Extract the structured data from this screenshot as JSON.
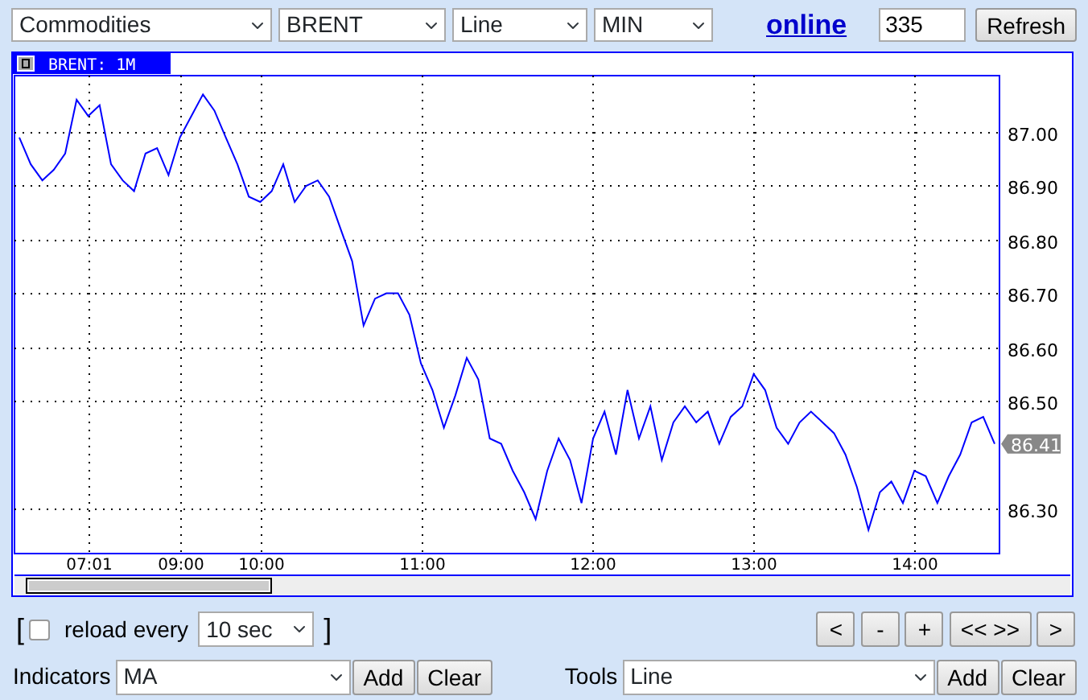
{
  "toolbar": {
    "selects": [
      {
        "value": "Commodities"
      },
      {
        "value": "BRENT"
      },
      {
        "value": "Line"
      },
      {
        "value": "MIN"
      }
    ],
    "online_link": "online",
    "count_field": {
      "value": "335"
    },
    "refresh_button": "Refresh"
  },
  "chart": {
    "tab_label": "BRENT: 1M",
    "chart_data": {
      "type": "line",
      "grid": true,
      "ylim": [
        86.216,
        87.105
      ],
      "yticks": [
        {
          "value": 86.3,
          "label": "86.30"
        },
        {
          "value": 86.5,
          "label": "86.50"
        },
        {
          "value": 86.6,
          "label": "86.60"
        },
        {
          "value": 86.7,
          "label": "86.70"
        },
        {
          "value": 86.8,
          "label": "86.80"
        },
        {
          "value": 86.9,
          "label": "86.90"
        },
        {
          "value": 87.0,
          "label": "87.00"
        }
      ],
      "categories": [
        null,
        null,
        null,
        null,
        null,
        null,
        "07:01",
        null,
        null,
        null,
        null,
        null,
        null,
        null,
        "09:00",
        null,
        null,
        null,
        null,
        null,
        null,
        "10:00",
        null,
        null,
        null,
        null,
        null,
        null,
        null,
        null,
        null,
        null,
        null,
        null,
        null,
        "11:00",
        null,
        null,
        null,
        null,
        null,
        null,
        null,
        null,
        null,
        null,
        null,
        null,
        null,
        null,
        "12:00",
        null,
        null,
        null,
        null,
        null,
        null,
        null,
        null,
        null,
        null,
        null,
        null,
        null,
        "13:00",
        null,
        null,
        null,
        null,
        null,
        null,
        null,
        null,
        null,
        null,
        null,
        null,
        null,
        "14:00",
        null,
        null,
        null,
        null,
        null,
        null,
        null
      ],
      "series": [
        {
          "color": "#0000ff",
          "values": [
            86.99,
            86.94,
            86.91,
            86.93,
            86.96,
            87.06,
            87.03,
            87.05,
            86.94,
            86.91,
            86.89,
            86.96,
            86.97,
            86.92,
            86.99,
            87.03,
            87.07,
            87.04,
            86.99,
            86.94,
            86.88,
            86.87,
            86.89,
            86.94,
            86.87,
            86.9,
            86.91,
            86.88,
            86.82,
            86.76,
            86.64,
            86.69,
            86.7,
            86.7,
            86.66,
            86.57,
            86.52,
            86.45,
            86.51,
            86.58,
            86.54,
            86.43,
            86.42,
            86.37,
            86.33,
            86.28,
            86.37,
            86.43,
            86.39,
            86.31,
            86.43,
            86.48,
            86.4,
            86.52,
            86.43,
            86.49,
            86.39,
            86.46,
            86.49,
            86.46,
            86.48,
            86.42,
            86.47,
            86.49,
            86.55,
            86.52,
            86.45,
            86.42,
            86.46,
            86.48,
            86.46,
            86.44,
            86.4,
            86.34,
            86.26,
            86.33,
            86.35,
            86.31,
            86.37,
            86.36,
            86.31,
            86.36,
            86.4,
            86.46,
            86.47,
            86.42
          ]
        }
      ],
      "annotations": [
        "86.41"
      ]
    }
  },
  "reload": {
    "open_bracket": "[",
    "close_bracket": "]",
    "checked": false,
    "label": "reload every",
    "interval": "10 sec",
    "nav_buttons": [
      "<",
      "-",
      "+",
      "<< >>",
      ">"
    ]
  },
  "indicators": {
    "label": "Indicators",
    "value": "MA",
    "add": "Add",
    "clear": "Clear"
  },
  "tools": {
    "label": "Tools",
    "value": "Line",
    "add": "Add",
    "clear": "Clear"
  }
}
